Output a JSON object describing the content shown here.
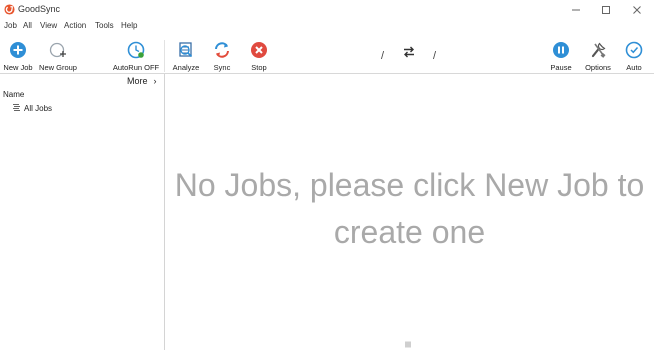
{
  "window": {
    "title": "GoodSync",
    "controls": [
      "minimize",
      "maximize",
      "close"
    ]
  },
  "menu": [
    "Job",
    "All",
    "View",
    "Action",
    "Tools",
    "Help"
  ],
  "toolbar": {
    "new_job": "New Job",
    "new_group": "New Group",
    "autorun": "AutoRun OFF",
    "analyze": "Analyze",
    "sync": "Sync",
    "stop": "Stop",
    "left_path": "/",
    "right_path": "/",
    "pause": "Pause",
    "options": "Options",
    "auto": "Auto"
  },
  "sidebar": {
    "more": "More",
    "column_header": "Name",
    "items": [
      {
        "label": "All Jobs",
        "icon": "jobs-list-icon"
      }
    ]
  },
  "main": {
    "empty_line1": "No Jobs, please click New Job to",
    "empty_line2": "create one"
  },
  "colors": {
    "accent_blue": "#2f8fd6",
    "stop_red": "#e04a3f",
    "sync_red": "#e24b3b",
    "placeholder_text": "#a9a9a9",
    "brand_logo": "#e8552d"
  }
}
